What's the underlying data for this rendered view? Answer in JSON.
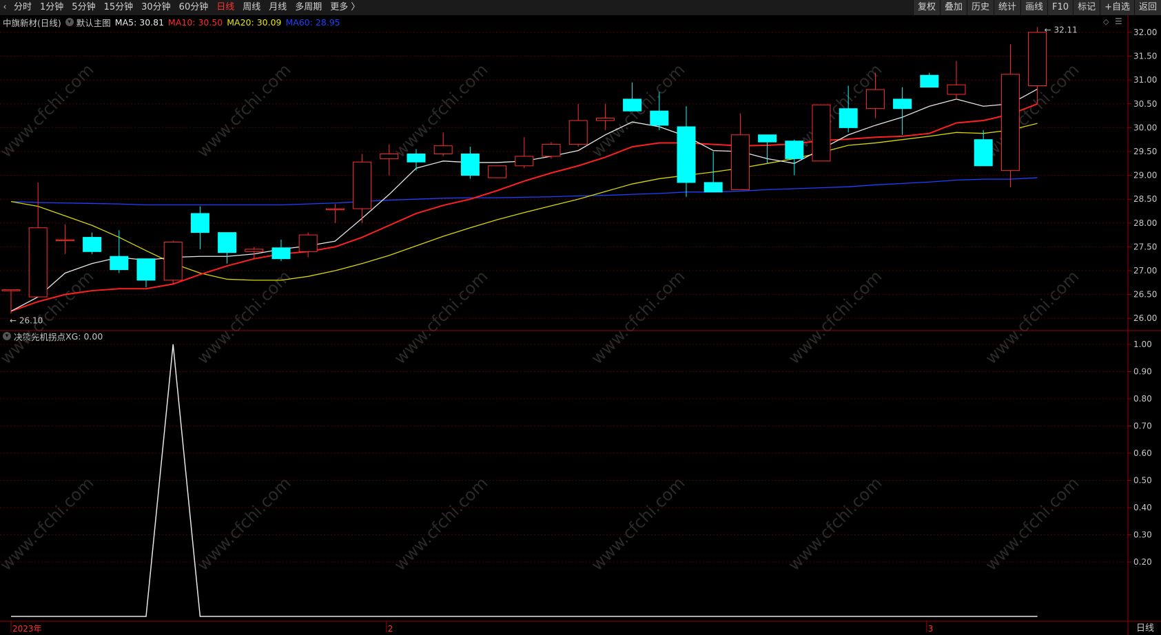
{
  "toolbar": {
    "left_items": [
      {
        "label": "分时",
        "active": false
      },
      {
        "label": "1分钟",
        "active": false
      },
      {
        "label": "5分钟",
        "active": false
      },
      {
        "label": "15分钟",
        "active": false
      },
      {
        "label": "30分钟",
        "active": false
      },
      {
        "label": "60分钟",
        "active": false
      },
      {
        "label": "日线",
        "active": true
      },
      {
        "label": "周线",
        "active": false
      },
      {
        "label": "月线",
        "active": false
      },
      {
        "label": "多周期",
        "active": false
      },
      {
        "label": "更多",
        "active": false
      }
    ],
    "right_items": [
      "复权",
      "叠加",
      "历史",
      "统计",
      "画线",
      "F10",
      "标记",
      "+自选",
      "返回"
    ]
  },
  "main_panel": {
    "stock_title": "中旗新材(日线)",
    "template": "默认主图",
    "ma_labels": [
      {
        "label": "MA5: 30.81",
        "color": "#e8e8e8"
      },
      {
        "label": "MA10: 30.50",
        "color": "#ff2a2a"
      },
      {
        "label": "MA20: 30.09",
        "color": "#e8e800"
      },
      {
        "label": "MA60: 28.95",
        "color": "#2040ff"
      }
    ],
    "y_ticks": [
      "32.00",
      "31.50",
      "31.00",
      "30.50",
      "30.00",
      "29.50",
      "29.00",
      "28.50",
      "28.00",
      "27.50",
      "27.00",
      "26.50",
      "26.00"
    ],
    "high_label": "32.11",
    "low_label": "26.10"
  },
  "indicator_panel": {
    "title": "决策先机拐点",
    "value_label": "XG: 0.00",
    "y_ticks": [
      "1.00",
      "0.90",
      "0.80",
      "0.70",
      "0.60",
      "0.50",
      "0.40",
      "0.30",
      "0.20"
    ]
  },
  "x_axis": {
    "labels": [
      {
        "text": "2023年",
        "index": 0
      },
      {
        "text": "2",
        "index": 14
      },
      {
        "text": "3",
        "index": 34
      }
    ]
  },
  "period_label": "日线",
  "watermark": "www.cfchi.com",
  "colors": {
    "up": "#ff3030",
    "down": "#00ffff",
    "ma5": "#e8e8e8",
    "ma10": "#ff2020",
    "ma20": "#d8d800",
    "ma60": "#2040ff",
    "grid": "#5a0000",
    "axis": "#a00000"
  },
  "chart_data": {
    "type": "candlestick",
    "ylim": [
      25.9,
      32.2
    ],
    "candles": [
      {
        "o": 26.6,
        "h": 26.6,
        "l": 26.1,
        "c": 26.6
      },
      {
        "o": 26.45,
        "h": 28.85,
        "l": 26.45,
        "c": 27.9
      },
      {
        "o": 27.65,
        "h": 27.97,
        "l": 27.35,
        "c": 27.65
      },
      {
        "o": 27.7,
        "h": 27.8,
        "l": 27.35,
        "c": 27.4
      },
      {
        "o": 27.3,
        "h": 27.85,
        "l": 26.95,
        "c": 27.02
      },
      {
        "o": 27.25,
        "h": 27.25,
        "l": 26.65,
        "c": 26.8
      },
      {
        "o": 26.8,
        "h": 27.63,
        "l": 26.7,
        "c": 27.6
      },
      {
        "o": 28.2,
        "h": 28.35,
        "l": 27.45,
        "c": 27.8
      },
      {
        "o": 27.8,
        "h": 27.8,
        "l": 27.15,
        "c": 27.38
      },
      {
        "o": 27.4,
        "h": 27.5,
        "l": 27.25,
        "c": 27.45
      },
      {
        "o": 27.48,
        "h": 27.65,
        "l": 27.2,
        "c": 27.25
      },
      {
        "o": 27.4,
        "h": 27.8,
        "l": 27.28,
        "c": 27.75
      },
      {
        "o": 28.3,
        "h": 28.4,
        "l": 28.0,
        "c": 28.3
      },
      {
        "o": 28.3,
        "h": 29.45,
        "l": 28.0,
        "c": 29.28
      },
      {
        "o": 29.35,
        "h": 29.65,
        "l": 29.0,
        "c": 29.45
      },
      {
        "o": 29.45,
        "h": 29.55,
        "l": 29.1,
        "c": 29.28
      },
      {
        "o": 29.45,
        "h": 29.9,
        "l": 29.4,
        "c": 29.62
      },
      {
        "o": 29.45,
        "h": 29.6,
        "l": 28.93,
        "c": 29.0
      },
      {
        "o": 28.95,
        "h": 29.15,
        "l": 28.95,
        "c": 29.2
      },
      {
        "o": 29.2,
        "h": 29.8,
        "l": 29.15,
        "c": 29.4
      },
      {
        "o": 29.4,
        "h": 29.7,
        "l": 29.35,
        "c": 29.65
      },
      {
        "o": 29.65,
        "h": 30.5,
        "l": 29.6,
        "c": 30.15
      },
      {
        "o": 30.15,
        "h": 30.5,
        "l": 29.95,
        "c": 30.2
      },
      {
        "o": 30.6,
        "h": 30.95,
        "l": 30.35,
        "c": 30.35
      },
      {
        "o": 30.35,
        "h": 30.75,
        "l": 29.95,
        "c": 30.05
      },
      {
        "o": 30.02,
        "h": 30.45,
        "l": 28.55,
        "c": 28.85
      },
      {
        "o": 28.85,
        "h": 29.5,
        "l": 28.65,
        "c": 28.65
      },
      {
        "o": 28.7,
        "h": 30.3,
        "l": 28.7,
        "c": 29.85
      },
      {
        "o": 29.85,
        "h": 29.85,
        "l": 29.25,
        "c": 29.7
      },
      {
        "o": 29.72,
        "h": 29.75,
        "l": 29.0,
        "c": 29.35
      },
      {
        "o": 29.3,
        "h": 30.48,
        "l": 29.3,
        "c": 30.48
      },
      {
        "o": 30.4,
        "h": 30.88,
        "l": 29.9,
        "c": 30.0
      },
      {
        "o": 30.4,
        "h": 31.15,
        "l": 30.2,
        "c": 30.8
      },
      {
        "o": 30.6,
        "h": 30.85,
        "l": 29.85,
        "c": 30.4
      },
      {
        "o": 31.1,
        "h": 31.15,
        "l": 30.85,
        "c": 30.85
      },
      {
        "o": 30.7,
        "h": 31.4,
        "l": 30.6,
        "c": 30.9
      },
      {
        "o": 29.75,
        "h": 29.95,
        "l": 29.25,
        "c": 29.2
      },
      {
        "o": 29.1,
        "h": 31.75,
        "l": 28.75,
        "c": 31.12
      },
      {
        "o": 30.88,
        "h": 32.11,
        "l": 30.5,
        "c": 32.0
      }
    ],
    "ma5": [
      26.15,
      26.45,
      26.95,
      27.15,
      27.28,
      27.22,
      27.28,
      27.3,
      27.3,
      27.35,
      27.45,
      27.52,
      27.62,
      28.1,
      28.6,
      29.15,
      29.3,
      29.27,
      29.27,
      29.3,
      29.4,
      29.52,
      29.85,
      30.12,
      30.02,
      29.82,
      29.52,
      29.5,
      29.35,
      29.25,
      29.55,
      29.85,
      30.05,
      30.22,
      30.45,
      30.6,
      30.45,
      30.5,
      30.81
    ],
    "ma10": [
      26.15,
      26.35,
      26.5,
      26.58,
      26.62,
      26.62,
      26.72,
      26.92,
      27.1,
      27.25,
      27.35,
      27.4,
      27.5,
      27.7,
      27.95,
      28.2,
      28.37,
      28.5,
      28.68,
      28.88,
      29.05,
      29.2,
      29.38,
      29.6,
      29.68,
      29.68,
      29.65,
      29.62,
      29.63,
      29.66,
      29.73,
      29.76,
      29.8,
      29.82,
      29.88,
      30.1,
      30.15,
      30.28,
      30.5
    ],
    "ma20": [
      28.45,
      28.35,
      28.15,
      27.95,
      27.7,
      27.42,
      27.15,
      26.95,
      26.82,
      26.8,
      26.8,
      26.88,
      27.0,
      27.15,
      27.32,
      27.52,
      27.72,
      27.9,
      28.07,
      28.22,
      28.36,
      28.5,
      28.66,
      28.82,
      28.93,
      29.0,
      29.07,
      29.15,
      29.25,
      29.35,
      29.48,
      29.63,
      29.68,
      29.75,
      29.82,
      29.9,
      29.88,
      29.95,
      30.09
    ],
    "ma60": [
      28.45,
      28.43,
      28.42,
      28.41,
      28.4,
      28.38,
      28.38,
      28.38,
      28.38,
      28.38,
      28.38,
      28.4,
      28.42,
      28.45,
      28.48,
      28.5,
      28.52,
      28.53,
      28.53,
      28.54,
      28.55,
      28.57,
      28.58,
      28.6,
      28.62,
      28.65,
      28.65,
      28.67,
      28.7,
      28.72,
      28.74,
      28.76,
      28.8,
      28.83,
      28.86,
      28.9,
      28.92,
      28.92,
      28.95
    ],
    "xg": [
      0,
      0,
      0,
      0,
      0,
      0,
      1,
      0,
      0,
      0,
      0,
      0,
      0,
      0,
      0,
      0,
      0,
      0,
      0,
      0,
      0,
      0,
      0,
      0,
      0,
      0,
      0,
      0,
      0,
      0,
      0,
      0,
      0,
      0,
      0,
      0,
      0,
      0,
      0
    ],
    "xg_ylim": [
      0.0,
      1.0
    ]
  }
}
